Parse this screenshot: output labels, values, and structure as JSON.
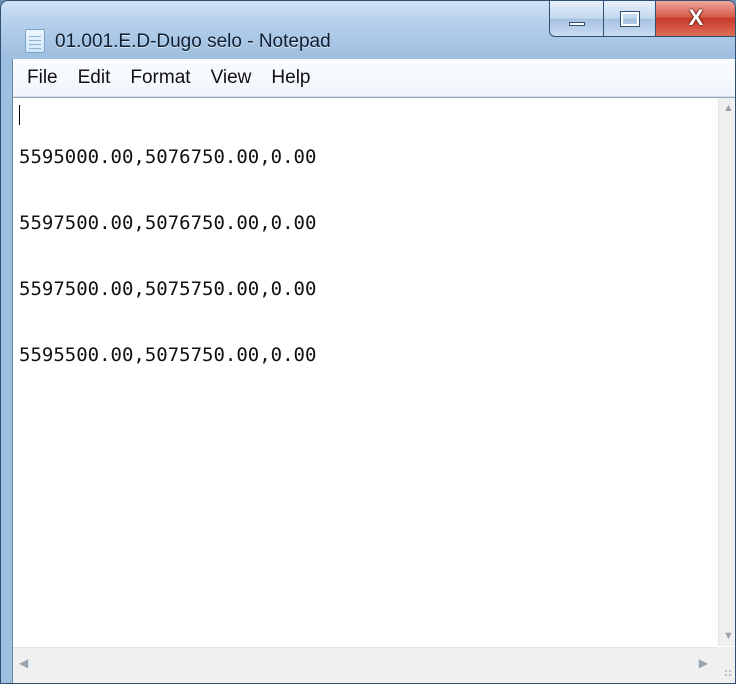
{
  "window": {
    "title": "01.001.E.D-Dugo selo - Notepad",
    "icon": "notepad-icon"
  },
  "caption_buttons": {
    "minimize_icon": "minimize-icon",
    "maximize_icon": "maximize-icon",
    "close_icon": "close-icon",
    "close_glyph": "X"
  },
  "menu": {
    "items": [
      {
        "label": "File"
      },
      {
        "label": "Edit"
      },
      {
        "label": "Format"
      },
      {
        "label": "View"
      },
      {
        "label": "Help"
      }
    ]
  },
  "editor": {
    "lines": [
      "5595000.00,5076750.00,0.00",
      "5597500.00,5076750.00,0.00",
      "5597500.00,5075750.00,0.00",
      "5595500.00,5075750.00,0.00"
    ]
  },
  "scrollbars": {
    "up_arrow_icon": "scroll-up-arrow-icon",
    "down_arrow_icon": "scroll-down-arrow-icon",
    "left_arrow_icon": "scroll-left-arrow-icon",
    "right_arrow_icon": "scroll-right-arrow-icon"
  },
  "colors": {
    "frame": "#9fbfdf",
    "close_button": "#c73a2a",
    "editor_bg": "#ffffff"
  }
}
